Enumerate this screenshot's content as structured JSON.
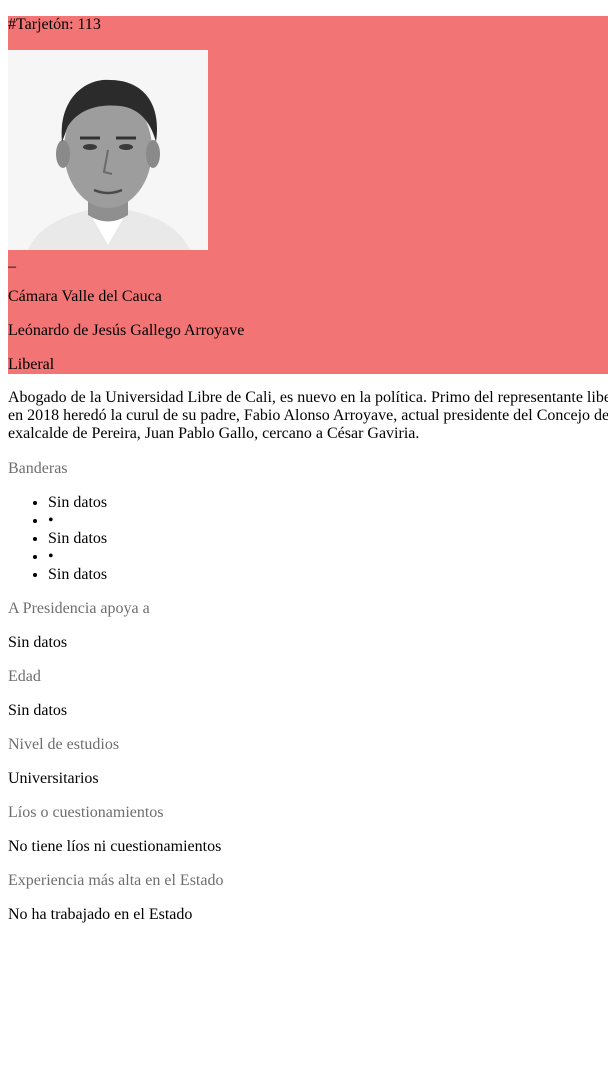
{
  "card": {
    "ballot": "#Tarjetón: 113",
    "dash": "–",
    "chamber": "Cámara Valle del Cauca",
    "name": "Leónardo de Jesús Gallego Arroyave",
    "party": "Liberal",
    "accent_color": "#f27474"
  },
  "bio": {
    "line1": "Abogado de la Universidad Libre de Cali, es nuevo en la política. Primo del representante liberal",
    "line2": "en 2018 heredó la curul de su padre, Fabio Alonso Arroyave, actual presidente del Concejo de",
    "line3": "exalcalde de Pereira, Juan Pablo Gallo, cercano a César Gaviria."
  },
  "banderas": {
    "label": "Banderas",
    "items": [
      "Sin datos",
      "•",
      "Sin datos",
      "•",
      "Sin datos"
    ]
  },
  "presidencia": {
    "label": "A Presidencia apoya a",
    "value": "Sin datos"
  },
  "edad": {
    "label": "Edad",
    "value": "Sin datos"
  },
  "estudios": {
    "label": "Nivel de estudios",
    "value": "Universitarios"
  },
  "lios": {
    "label": "Líos o cuestionamientos",
    "value": "No tiene líos ni cuestionamientos"
  },
  "experiencia": {
    "label": "Experiencia más alta en el Estado",
    "value": "No ha trabajado en el Estado"
  }
}
